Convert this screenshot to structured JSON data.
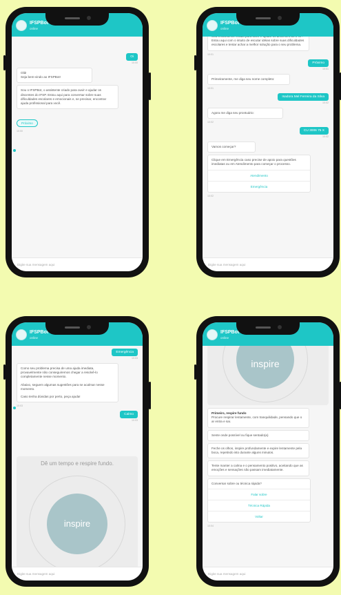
{
  "app": {
    "name": "IFSPBot",
    "status": "online"
  },
  "composer_placeholder": "Digite sua mensagem aqui",
  "brand_color": "#1ec6c6",
  "screen1": {
    "user_hi": "Oi",
    "time1": "10:00",
    "bot_greeting": [
      "Olá!",
      "Seja bem-vindo ao IFSPBot!"
    ],
    "bot_intro": "Sou o IFSPBot, o assistente criado para ouvir e ajudar os discentes do IFSP. Estou aqui para conversar sobre suas dificuldades escolares e emocionais e, se precisar, encontrar ajuda profissional para você.",
    "button": "Próximo",
    "time2": "10:00"
  },
  "screen2": {
    "bot_top": "Sou o assistente criado para ouvir e ajudar os discentes do IFSP. Estou aqui com o intuito de escutar idéias sobre suas dificuldades escolares e tentar achar a melhor solução para o seu problema.",
    "time0": "10:01",
    "user1": "Próximo",
    "time1": "10:01",
    "bot_name": "Primeiramente, me diga seu nome completo:",
    "time2": "10:01",
    "user_name": "Isadora Mel Ferreira da Silva",
    "time3": "10:02",
    "bot_phone": "Agora me diga seu prontuário:",
    "time4": "10:02",
    "user_phone": "CU 3006 75 X",
    "time5": "10:02",
    "bot_start": "Vamos começar?",
    "card_text": "Clique em Emergência caso precise de apoio para questões imediatas ou em Atendimento para começar o processo.",
    "opt1": "Atendimento",
    "opt2": "Emergência",
    "time6": "10:02"
  },
  "screen3": {
    "user1": "Emergência",
    "time1": "10:03",
    "bot_p1": "Como seu problema precisa de uma ajuda imediata, provavelmente não conseguiremos chegar a resolvê-lo completamente nesse momento.",
    "bot_p2": "Abaixo, seguem algumas sugestões para se acalmar nesse momento.",
    "bot_p3": "Caso tenha dúvidas por perto, peça ajuda!",
    "time2": "10:03",
    "user2": "Calmo",
    "time3": "10:03",
    "breathe_title": "Dê um tempo e respire fundo.",
    "breathe_word": "inspire"
  },
  "screen4": {
    "breathe_word": "inspire",
    "step_title": "Primeiro, respire fundo",
    "step_text": "Procure respirar lentamente, com tranquilidade, pensando que o ar entra e sai.",
    "b1": "Sente onde possível ou fique sentado(a)",
    "b2": "Feche os olhos, inspire profundamente e expire lentamente pela boca, repetindo isto durante alguns minutos.",
    "b3": "Tente manter a calma e o pensamento positivo, aceitando que as emoções e sensações não passam imediatamente.",
    "question": "Conversar sobre ou técnica rápida?",
    "opt1": "Falar sobre",
    "opt2": "Técnica Rápida",
    "opt3": "Voltar",
    "time1": "10:04"
  }
}
